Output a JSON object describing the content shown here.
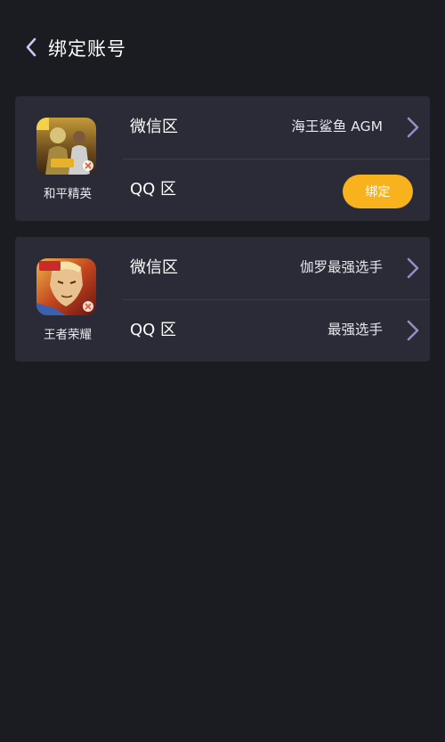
{
  "header": {
    "title": "绑定账号",
    "back_icon": "chevron-left-icon"
  },
  "colors": {
    "background": "#1b1b22",
    "card": "#2b2b37",
    "accent": "#f7b21e",
    "chevron": "#8f8fc5"
  },
  "cards": [
    {
      "game_name": "和平精英",
      "icon": "peacekeeper-elite-game-icon",
      "rows": [
        {
          "label": "微信区",
          "value": "海王鲨鱼 AGM",
          "action": "chevron"
        },
        {
          "label": "QQ 区",
          "value": "",
          "action": "button",
          "button_label": "绑定"
        }
      ]
    },
    {
      "game_name": "王者荣耀",
      "icon": "honor-of-kings-game-icon",
      "rows": [
        {
          "label": "微信区",
          "value": "伽罗最强选手",
          "action": "chevron"
        },
        {
          "label": "QQ 区",
          "value": "最强选手",
          "action": "chevron"
        }
      ]
    }
  ]
}
